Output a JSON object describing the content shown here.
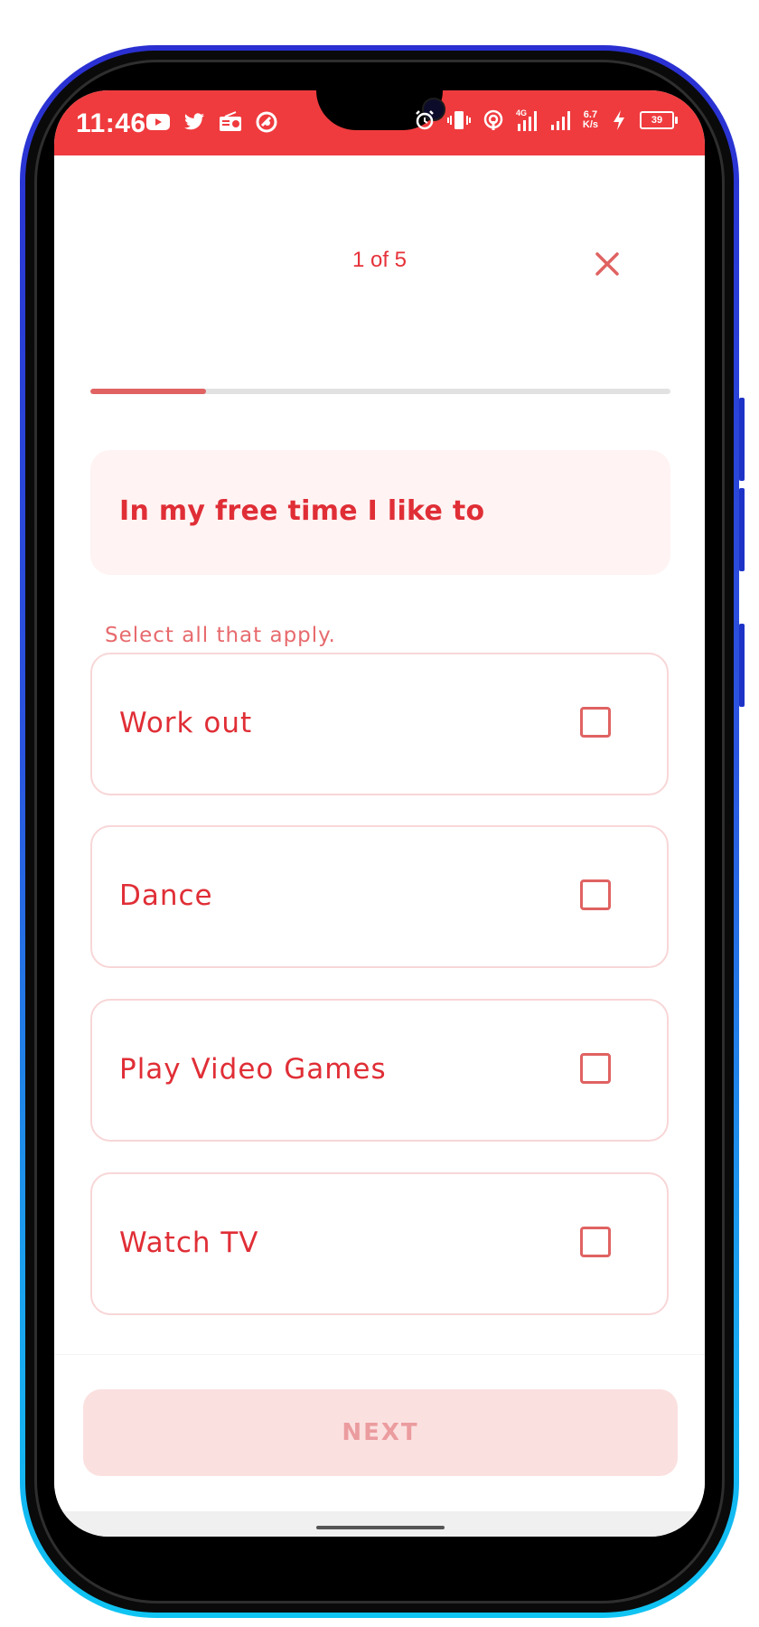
{
  "status_bar": {
    "time": "11:46",
    "left_icons": [
      "youtube-icon",
      "twitter-icon",
      "radio-icon",
      "accessibility-icon"
    ],
    "right_icons": [
      "alarm-icon",
      "vibrate-icon",
      "hotspot-icon",
      "signal-4g-icon",
      "signal-icon"
    ],
    "net_speed_value": "6.7",
    "net_speed_unit": "K/s",
    "battery_level": "39",
    "accent": "#ef3b3e"
  },
  "header": {
    "step_label": "1 of 5",
    "close_icon": "close-icon",
    "progress_fraction": 0.2
  },
  "question": {
    "text": "In my free time I like to",
    "hint": "Select all that apply."
  },
  "options": [
    {
      "label": "Work out",
      "checked": false
    },
    {
      "label": "Dance",
      "checked": false
    },
    {
      "label": "Play Video Games",
      "checked": false
    },
    {
      "label": "Watch TV",
      "checked": false
    }
  ],
  "footer": {
    "next_label": "NEXT",
    "next_enabled": false
  }
}
